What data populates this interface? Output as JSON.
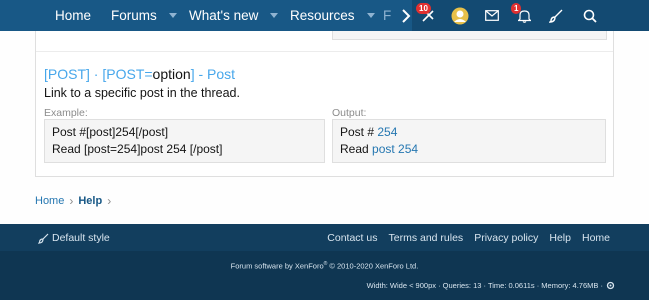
{
  "nav": {
    "items": [
      {
        "label": "Home"
      },
      {
        "label": "Forums"
      },
      {
        "label": "What's new"
      },
      {
        "label": "Resources"
      },
      {
        "label": "F"
      }
    ],
    "badges": {
      "tools": "10",
      "alerts": "1"
    }
  },
  "bbcode": {
    "title_open": "[POST]",
    "title_sep": " · ",
    "title_opt_open": "[POST=",
    "title_opt_word": "option",
    "title_opt_close": "]",
    "title_suffix": " - Post",
    "description": "Link to a specific post in the thread.",
    "example_label": "Example:",
    "output_label": "Output:",
    "example_line1": "Post #[post]254[/post]",
    "example_line2": "Read [post=254]post 254 [/post]",
    "output_line1_prefix": "Post # ",
    "output_line1_link": "254",
    "output_line2_prefix": "Read ",
    "output_line2_link": "post 254"
  },
  "breadcrumb": {
    "home": "Home",
    "help": "Help"
  },
  "footer": {
    "style_label": "Default style",
    "links": [
      "Contact us",
      "Terms and rules",
      "Privacy policy",
      "Help",
      "Home"
    ],
    "copyright_pre": "Forum software by XenForo",
    "copyright_reg": "®",
    "copyright_post": " © 2010-2020 XenForo Ltd.",
    "debug": "Width: Wide < 900px · Queries: 13 · Time: 0.0611s · Memory: 4.76MB ·"
  },
  "colors": {
    "nav": "#185886",
    "link": "#47a7eb",
    "footer": "#0f3652"
  }
}
